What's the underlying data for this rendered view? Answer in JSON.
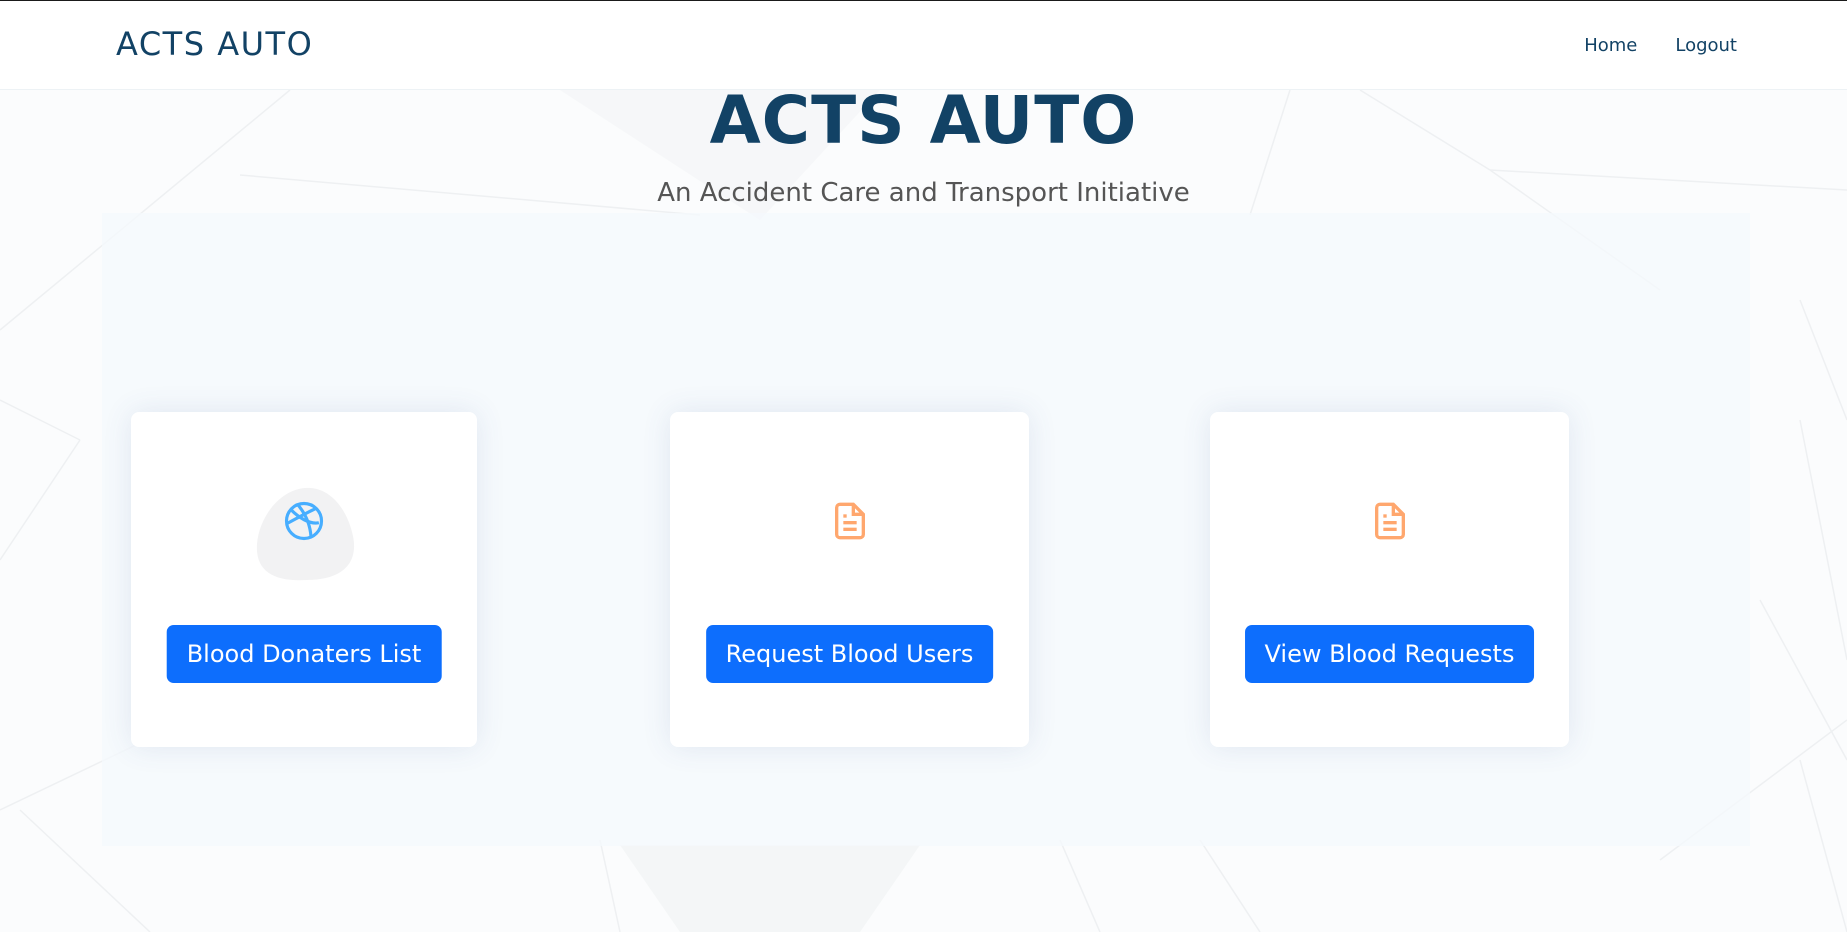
{
  "header": {
    "brand": "ACTS AUTO",
    "nav": [
      {
        "label": "Home"
      },
      {
        "label": "Logout"
      }
    ]
  },
  "hero": {
    "title": "ACTS AUTO",
    "subtitle": "An Accident Care and Transport Initiative"
  },
  "cards": [
    {
      "icon": "dribbble-icon",
      "icon_color": "#47aeff",
      "button_label": "Blood Donaters List"
    },
    {
      "icon": "file-icon",
      "icon_color": "#ffa76e",
      "button_label": "Request Blood Users"
    },
    {
      "icon": "file-icon",
      "icon_color": "#ffa76e",
      "button_label": "View Blood Requests"
    }
  ],
  "colors": {
    "brand": "#124265",
    "button": "#0d6efd"
  }
}
